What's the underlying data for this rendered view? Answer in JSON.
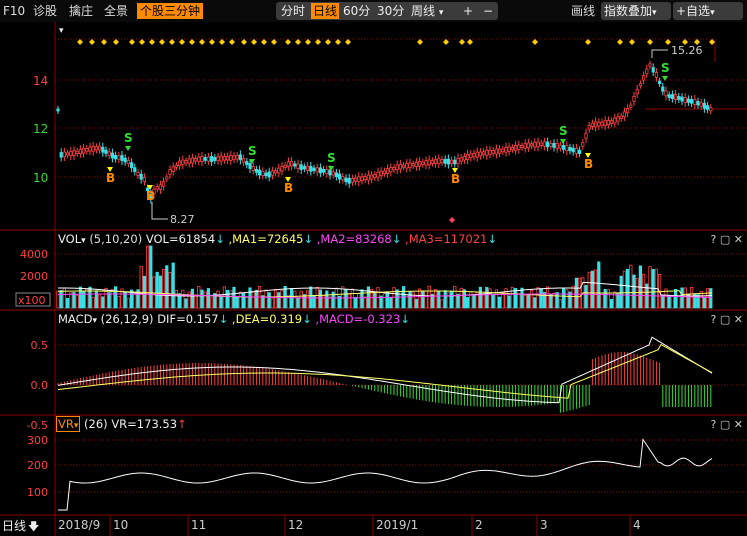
{
  "topbar": {
    "f10": "F10",
    "diag": "诊股",
    "pick": "擒庄",
    "full": "全景",
    "tab_active": "个股三分钟",
    "periods": [
      "分时",
      "日线",
      "60分",
      "30分"
    ],
    "period_active": 1,
    "week": "周线",
    "plus": "+",
    "minus": "−",
    "draw": "画线",
    "overlay": "指数叠加",
    "add": "+自选"
  },
  "price_panel": {
    "y_ticks": [
      "14",
      "12",
      "10"
    ],
    "high_label": "15.26",
    "low_label": "8.27",
    "buy_label": "B",
    "sell_label": "S"
  },
  "vol_panel": {
    "name": "VOL",
    "params": "(5,10,20)",
    "value": "VOL=61854",
    "ma1": ",MA1=72645",
    "ma2": ",MA2=83268",
    "ma3": ",MA3=117021",
    "ticks": [
      "4000",
      "2000"
    ],
    "unit": "x100"
  },
  "macd_panel": {
    "name": "MACD",
    "params": "(26,12,9)",
    "dif": "DIF=0.157",
    "dea": ",DEA=0.319",
    "macd": ",MACD=-0.323",
    "ticks": [
      "0.5",
      "0.0",
      "-0.5"
    ]
  },
  "vr_panel": {
    "name": "VR",
    "params": "(26)",
    "value": "VR=173.53",
    "ticks": [
      "300",
      "200",
      "100"
    ]
  },
  "panel_ctrls": "? ▢ ✕",
  "xaxis": {
    "period": "日线",
    "labels": [
      "2018/9",
      "10",
      "11",
      "12",
      "2019/1",
      "2",
      "3",
      "4"
    ]
  },
  "colors": {
    "up": "#ff4040",
    "down": "#38e0e6",
    "accent": "#ff8a00",
    "signal": "#ffcc00",
    "dea": "#ffff66",
    "macd": "#ff44ff"
  }
}
